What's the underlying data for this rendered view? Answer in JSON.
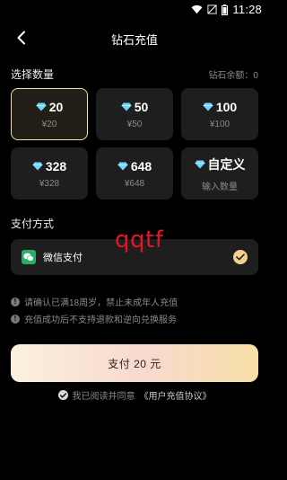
{
  "status_bar": {
    "time": "11:28"
  },
  "nav": {
    "title": "钻石充值"
  },
  "quantity": {
    "section_title": "选择数量",
    "balance_text": "钻石余额：0",
    "options": [
      {
        "amount": "20",
        "price": "¥20",
        "selected": true
      },
      {
        "amount": "50",
        "price": "¥50",
        "selected": false
      },
      {
        "amount": "100",
        "price": "¥100",
        "selected": false
      },
      {
        "amount": "328",
        "price": "¥328",
        "selected": false
      },
      {
        "amount": "648",
        "price": "¥648",
        "selected": false
      },
      {
        "amount": "自定义",
        "price": "输入数量",
        "selected": false
      }
    ]
  },
  "payment": {
    "section_title": "支付方式",
    "method_label": "微信支付",
    "selected": true
  },
  "watermark": "qqtf",
  "notices": [
    "请确认已满18周岁，禁止未成年人充值",
    "充值成功后不支持退款和逆向兑换服务"
  ],
  "pay_button": {
    "label": "支付 20 元"
  },
  "agreement": {
    "prefix": "我已阅读并同意",
    "link": "《用户充值协议》"
  },
  "colors": {
    "background": "#000000",
    "tile": "#1e1e1e",
    "accent_gold": "#f3dea4",
    "wechat_green": "#2aae67",
    "diamond_blue": "#6fd8ff"
  }
}
